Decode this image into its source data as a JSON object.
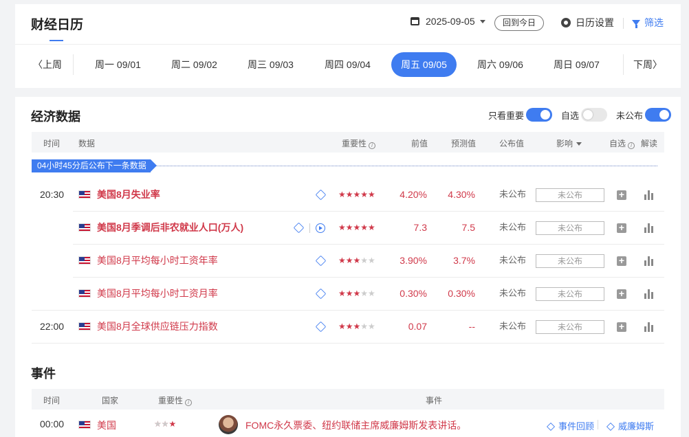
{
  "header": {
    "title": "财经日历",
    "date": "2025-09-05",
    "today_label": "回到今日",
    "settings_label": "日历设置",
    "filter_label": "筛选"
  },
  "week_nav": {
    "prev": "上周",
    "next": "下周",
    "days": [
      "周一 09/01",
      "周二 09/02",
      "周三 09/03",
      "周四 09/04",
      "周五 09/05",
      "周六 09/06",
      "周日 09/07"
    ],
    "active_index": 4
  },
  "econ": {
    "title": "经济数据",
    "toggles": [
      {
        "label": "只看重要",
        "on": true
      },
      {
        "label": "自选",
        "on": false
      },
      {
        "label": "未公布",
        "on": true
      }
    ],
    "columns": {
      "time": "时间",
      "data": "数据",
      "importance": "重要性",
      "previous": "前值",
      "forecast": "预测值",
      "actual": "公布值",
      "impact": "影响",
      "watch": "自选",
      "interpret": "解读"
    },
    "countdown": "04小时45分后公布下一条数据",
    "rows": [
      {
        "time": "20:30",
        "name": "美国8月失业率",
        "bold": true,
        "play": false,
        "stars": 5,
        "previous": "4.20%",
        "forecast": "4.30%",
        "actual": "未公布",
        "impact": "未公布"
      },
      {
        "time": "",
        "name": "美国8月季调后非农就业人口(万人)",
        "bold": true,
        "play": true,
        "stars": 5,
        "previous": "7.3",
        "forecast": "7.5",
        "actual": "未公布",
        "impact": "未公布"
      },
      {
        "time": "",
        "name": "美国8月平均每小时工资年率",
        "bold": false,
        "play": false,
        "stars": 3,
        "previous": "3.90%",
        "forecast": "3.7%",
        "actual": "未公布",
        "impact": "未公布"
      },
      {
        "time": "",
        "name": "美国8月平均每小时工资月率",
        "bold": false,
        "play": false,
        "stars": 3,
        "previous": "0.30%",
        "forecast": "0.30%",
        "actual": "未公布",
        "impact": "未公布"
      },
      {
        "time": "22:00",
        "name": "美国8月全球供应链压力指数",
        "bold": false,
        "play": false,
        "stars": 3,
        "previous": "0.07",
        "forecast": "--",
        "actual": "未公布",
        "impact": "未公布"
      }
    ]
  },
  "events": {
    "title": "事件",
    "columns": {
      "time": "时间",
      "country": "国家",
      "importance": "重要性",
      "event": "事件"
    },
    "rows": [
      {
        "time": "00:00",
        "country": "美国",
        "stars": 3,
        "text": "FOMC永久票委、纽约联储主席威廉姆斯发表讲话。",
        "review": "事件回顾",
        "person": "威廉姆斯"
      }
    ]
  },
  "colors": {
    "accent": "#3f7cf0",
    "highlight": "#d0394a"
  },
  "icons": {
    "date": "calendar-icon",
    "settings": "gear-icon",
    "filter": "funnel-icon",
    "analysis": "cube-icon",
    "video": "play-icon",
    "add": "plus-icon",
    "chart": "bar-chart-icon"
  }
}
